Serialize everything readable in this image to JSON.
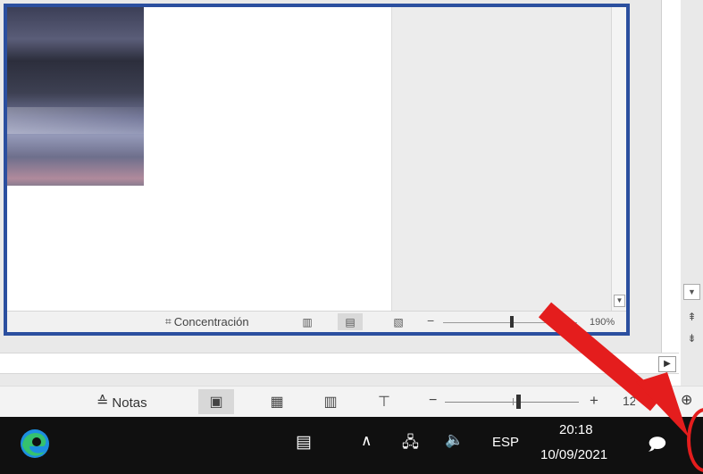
{
  "word_window": {
    "status": {
      "focus_label": "Concentración",
      "zoom_minus": "−",
      "zoom_percent": "190%"
    }
  },
  "ppt_window": {
    "status": {
      "notes_label": "Notas",
      "zoom_minus": "−",
      "zoom_plus": "+",
      "zoom_percent": "12"
    }
  },
  "taskbar": {
    "language": "ESP",
    "time": "20:18",
    "date": "10/09/2021"
  },
  "colors": {
    "highlight_border": "#2b4f9f",
    "annotation_red": "#e41d1d",
    "taskbar_bg": "#101010"
  },
  "icons": [
    "edge-icon",
    "news-widget-icon",
    "chevron-up-icon",
    "network-icon",
    "volume-icon",
    "notification-icon"
  ]
}
